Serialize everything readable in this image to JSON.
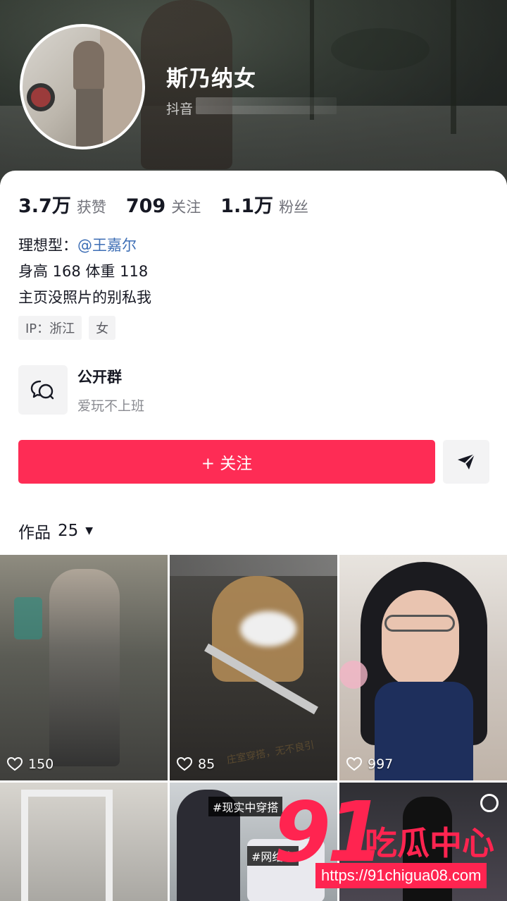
{
  "profile": {
    "username": "斯乃纳女",
    "platform_label": "抖音"
  },
  "stats": [
    {
      "value": "3.7万",
      "label": "获赞"
    },
    {
      "value": "709",
      "label": "关注"
    },
    {
      "value": "1.1万",
      "label": "粉丝"
    }
  ],
  "bio": {
    "line1_prefix": "理想型：",
    "line1_mention": "@王嘉尔",
    "line2": "身高 168 体重 118",
    "line3": "主页没照片的别私我"
  },
  "tags": [
    "IP：浙江",
    "女"
  ],
  "group": {
    "title": "公开群",
    "subtitle": "爱玩不上班",
    "icon": "chat-group-icon"
  },
  "actions": {
    "follow_label": "+ 关注",
    "share_icon": "send-icon"
  },
  "works": {
    "label": "作品",
    "count": "25",
    "items": [
      {
        "likes": "150"
      },
      {
        "likes": "85",
        "caption": "庄室穿搭，无不良引"
      },
      {
        "likes": "997"
      },
      {
        "likes": ""
      },
      {
        "likes": "",
        "caption_top": "#现实中穿搭",
        "caption_bottom": "#网络上"
      },
      {
        "likes": ""
      }
    ]
  },
  "watermark": {
    "number": "91",
    "text": "吃瓜中心",
    "url": "https://91chigua08.com"
  },
  "colors": {
    "accent": "#fe2c55",
    "mention": "#3d6eb5"
  }
}
